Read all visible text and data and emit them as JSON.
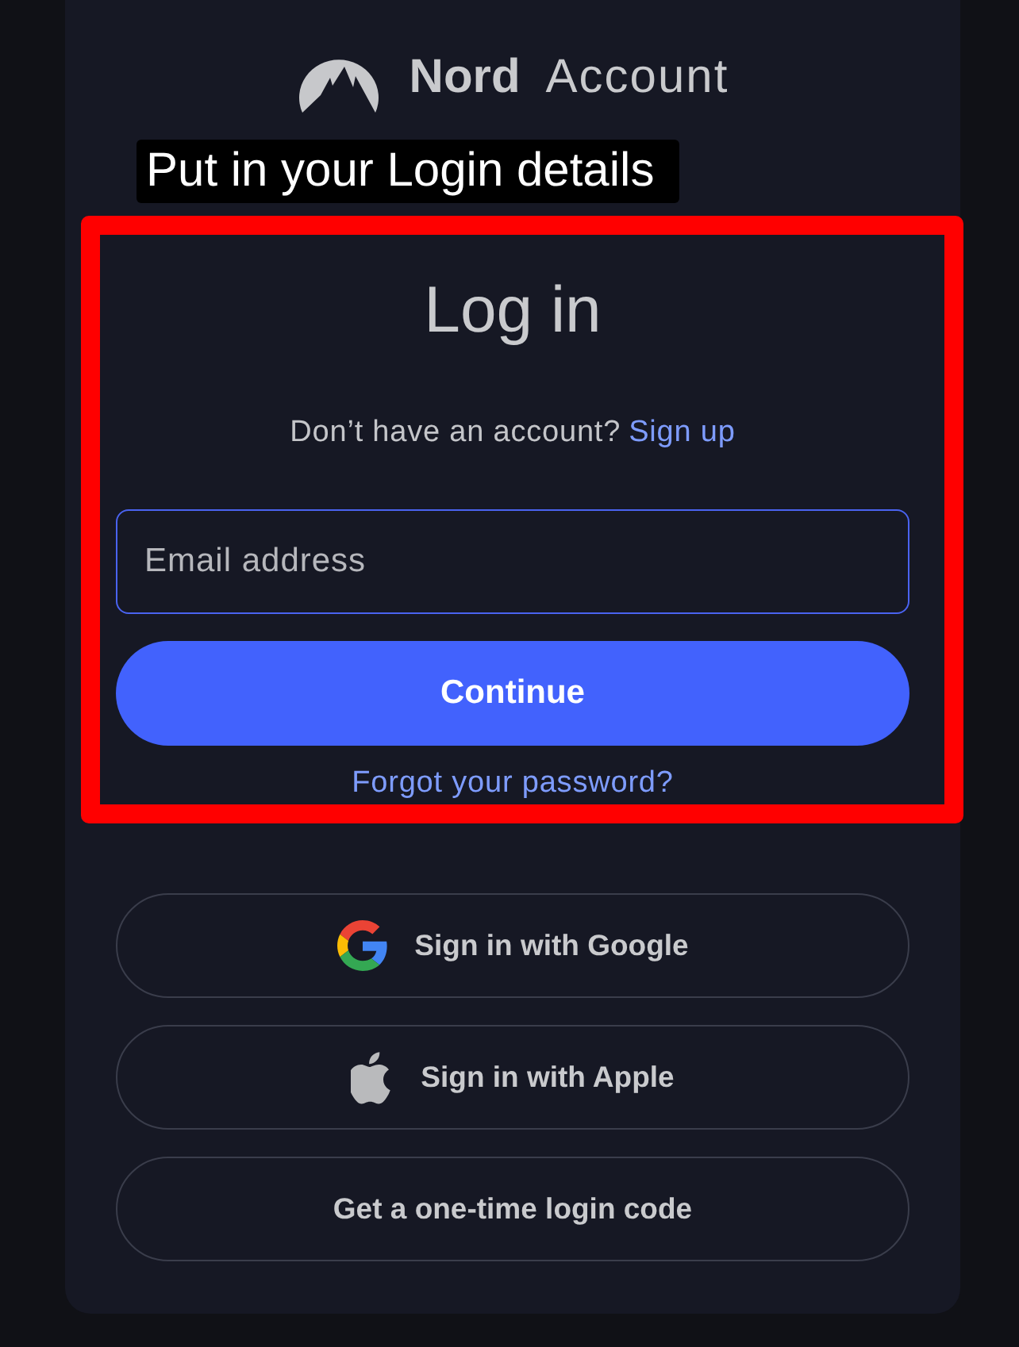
{
  "header": {
    "brand": "Nord",
    "product": "Account"
  },
  "annotation": {
    "label": "Put in your Login details",
    "highlighted": true
  },
  "login": {
    "title": "Log in",
    "signup_prompt": "Don’t have an account?",
    "signup_link": "Sign up",
    "email_field": {
      "placeholder": "Email address",
      "focused": true
    },
    "submit": "Continue",
    "forgot_link": "Forgot your password?"
  },
  "alternatives": [
    {
      "kind": "google",
      "label": "Sign in with Google"
    },
    {
      "kind": "apple",
      "label": "Sign in with Apple"
    },
    {
      "kind": "plain",
      "label": "Get a one-time login code"
    }
  ]
}
